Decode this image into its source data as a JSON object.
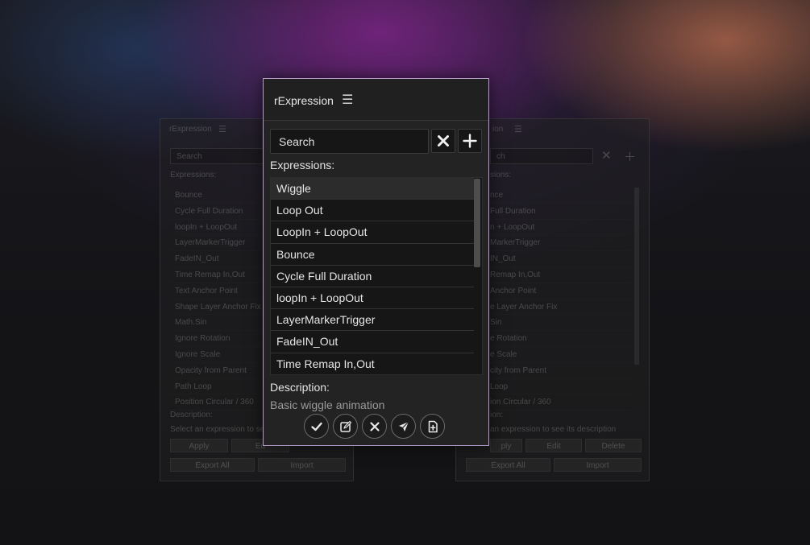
{
  "panel": {
    "title": "rExpression",
    "search_placeholder": "Search",
    "expressions_label": "Expressions:",
    "items": [
      {
        "label": "Wiggle",
        "selected": true
      },
      {
        "label": "Loop Out"
      },
      {
        "label": "LoopIn + LoopOut"
      },
      {
        "label": "Bounce"
      },
      {
        "label": "Cycle Full Duration"
      },
      {
        "label": "loopIn + LoopOut"
      },
      {
        "label": "LayerMarkerTrigger"
      },
      {
        "label": "FadeIN_Out"
      },
      {
        "label": "Time Remap In,Out"
      }
    ],
    "description_label": "Description:",
    "description_text": "Basic wiggle animation",
    "actions": [
      "apply-icon",
      "edit-icon",
      "delete-icon",
      "send-icon",
      "import-file-icon"
    ],
    "border_color": "#b69ac9"
  },
  "ghost_left": {
    "title": "rExpression",
    "search": "Search",
    "expressions_label": "Expressions:",
    "items": [
      "Bounce",
      "Cycle Full Duration",
      "loopIn + LoopOut",
      "LayerMarkerTrigger",
      "FadeIN_Out",
      "Time Remap In,Out",
      "Text Anchor Point",
      "Shape Layer Anchor Fix",
      "Math.Sin",
      "Ignore Rotation",
      "Ignore Scale",
      "Opacity from Parent",
      "Path Loop",
      "Position Circular / 360"
    ],
    "description_label": "Description:",
    "description_text": "Select an expression to se",
    "apply": "Apply",
    "edit": "Ed",
    "export_all": "Export All",
    "import": "Import"
  },
  "ghost_right": {
    "title": "ion",
    "search": "ch",
    "expressions_label": "sions:",
    "items": [
      "nce",
      "Full Duration",
      "n + LoopOut",
      "MarkerTrigger",
      "IN_Out",
      "Remap In,Out",
      "Anchor Point",
      "e Layer Anchor Fix",
      "Sin",
      "e Rotation",
      "e Scale",
      "city from Parent",
      "Loop",
      "ion Circular / 360"
    ],
    "description_label": "ion:",
    "description_text": "an expression to see its description",
    "apply": "ply",
    "edit": "Edit",
    "delete": "Delete",
    "export_all": "Export All",
    "import": "Import"
  }
}
